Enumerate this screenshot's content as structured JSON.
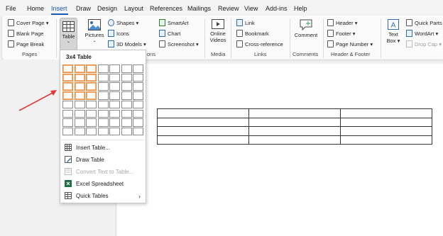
{
  "menu": {
    "items": [
      "File",
      "Home",
      "Insert",
      "Draw",
      "Design",
      "Layout",
      "References",
      "Mailings",
      "Review",
      "View",
      "Add-ins",
      "Help"
    ],
    "active": "Insert"
  },
  "ribbon": {
    "pages": {
      "cover_page": "Cover Page",
      "blank_page": "Blank Page",
      "page_break": "Page Break",
      "group_label": "Pages"
    },
    "tables": {
      "table_label": "Table"
    },
    "illustrations": {
      "pictures": "Pictures",
      "shapes": "Shapes",
      "icons": "Icons",
      "models_3d": "3D Models",
      "smartart": "SmartArt",
      "chart": "Chart",
      "screenshot": "Screenshot",
      "group_label_partial": "ons"
    },
    "media": {
      "online_videos_line1": "Online",
      "online_videos_line2": "Videos",
      "group_label": "Media"
    },
    "links": {
      "link": "Link",
      "bookmark": "Bookmark",
      "cross_reference": "Cross-reference",
      "group_label": "Links"
    },
    "comments": {
      "comment": "Comment",
      "group_label": "Comments"
    },
    "header_footer": {
      "header": "Header",
      "footer": "Footer",
      "page_number": "Page Number",
      "group_label": "Header & Footer"
    },
    "text": {
      "text_box_line1": "Text",
      "text_box_line2": "Box",
      "quick_parts": "Quick Parts",
      "wordart": "WordArt",
      "drop_cap": "Drop Cap"
    }
  },
  "table_dropdown": {
    "title": "3x4 Table",
    "grid_rows": 8,
    "grid_cols": 7,
    "selected_rows": 4,
    "selected_cols": 3,
    "items": [
      {
        "label": "Insert Table...",
        "disabled": false
      },
      {
        "label": "Draw Table",
        "disabled": false
      },
      {
        "label": "Convert Text to Table...",
        "disabled": true
      },
      {
        "label": "Excel Spreadsheet",
        "disabled": false
      },
      {
        "label": "Quick Tables",
        "disabled": false
      }
    ],
    "submenu_chevron": "›"
  },
  "document_table": {
    "rows": 4,
    "cols": 3
  },
  "colors": {
    "accent": "#185abd",
    "selection": "#e8883a",
    "arrow": "#e03a3a"
  }
}
